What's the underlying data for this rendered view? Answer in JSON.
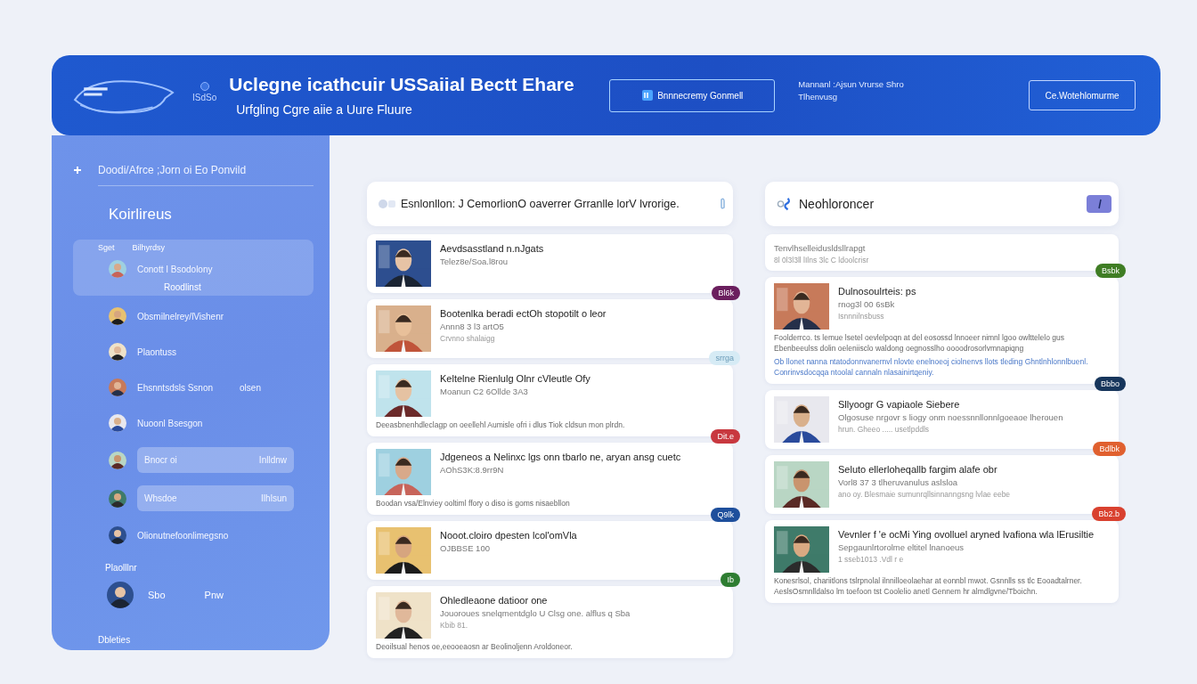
{
  "header": {
    "badge": "ISdSo",
    "title": "Uclegne icathcuir USSaiial Bectt Ehare",
    "subtitle": "Urfgling Cgre aiie a Uure Fluure",
    "primary_button": "Bnnnecremy Gonmell",
    "info": [
      "Mannanl :Ajsun Vrurse Shro",
      "Tlhenvusg"
    ],
    "secondary_button": "Ce.Wotehlomurme"
  },
  "sidebar": {
    "top_link": "Doodi/Afrce ;Jorn oi Eo Ponvild",
    "heading": "Koirlireus",
    "group": {
      "tag": "Sget",
      "label": "Bilhyrdsy"
    },
    "items": [
      {
        "label": "Conott I Bsodolony",
        "sublabel": "Roodlinst",
        "selected": true
      },
      {
        "label": "Obsmilnelrey/lVishenr",
        "selected": false
      },
      {
        "label": "Plaontuss",
        "selected": false
      },
      {
        "label": "Ehsnntsdsls Ssnon",
        "value": "olsen",
        "selected": false
      },
      {
        "label": "Nuoonl Bsesgon",
        "selected": false
      },
      {
        "label": "Bnocr oi",
        "value": "Inlldnw",
        "selected": true
      },
      {
        "label": "Whsdoe",
        "value": "Ilhlsun",
        "selected": true
      },
      {
        "label": "Olionutnefoonlimegsno",
        "selected": false
      }
    ],
    "section": "Plaolllnr",
    "profile": {
      "name": "Sbo",
      "value": "Pnw"
    },
    "footer": "Dbleties"
  },
  "feed": {
    "title": "Esnlonllon: J CemorlionO oaverrer Grranlle lorV lvrorige.",
    "posts": [
      {
        "title": "Aevdsasstland n.nJgats",
        "subtitle": "Telez8e/Soa.l8rou",
        "badge": "Bl6k",
        "color": "#6b1f5e"
      },
      {
        "title": "Bootenlka beradi ectOh stopotilt o leor",
        "subtitle": "Annn8 3 l3 artO5",
        "meta": "Crvnno shalaigg",
        "badge": "srrga",
        "color": "#d6ebf5"
      },
      {
        "title": "Keltelne Rienlulg Olnr cVleutle Ofy",
        "subtitle": "Moanun C2 6Ollde 3A3",
        "description": "Deeasbnenhdleclagp on oeellehl Aumisle ofri i dlus Tiok cldsun mon plrdn.",
        "badge": "Dit.e",
        "color": "#c8383f"
      },
      {
        "title": "Jdgeneos a Nelinxc lgs onn tbarlo ne, aryan ansg cuetc",
        "subtitle": "AOhS3K:8.9rr9N",
        "description": "Boodan vsa/Elnviey ooltiml ffory o diso is goms nisaebllon",
        "badge": "Q9lk",
        "color": "#1e4f9c"
      },
      {
        "title": "Nooot.cloiro dpesten lcol'omVla",
        "subtitle": "OJBBSE 100",
        "badge": "Ib",
        "color": "#2e7d32"
      },
      {
        "title": "Ohledleaone datioor one",
        "subtitle": "Jouoroues snelqmentdglo U Clsg one. alflus q Sba",
        "meta": "Kbib 81.",
        "description": "Deoilsual henos oe,eeooeaosn ar Beolinoljenn Aroldoneor."
      }
    ]
  },
  "panel": {
    "title": "Neohloroncer",
    "posts": [
      {
        "subtitle": "Tenvlhselleidusldsllrapgt",
        "meta": "8l  0l3l3ll  lIlns  3lc  C ldoolcrisr",
        "badge": "Bsbk",
        "color": "#3f7d24"
      },
      {
        "title": "Dulnosoulrteis: ps",
        "subtitle": "rnog3l 00 6sBk",
        "meta": "Isnnnilnsbuss",
        "description": "Foolderrco. ts lemue lsetel oevlelpoqn at del eosossd lnnoeer nimnl lgoo owlttelelo gus Ebenbeeulss dolin oeleniisclo waldong oegnosslho oooodrosorlvmnapiqng",
        "note": "Ob llonet nanna ntatodonnvanernvl nlovte enelnoeoj ciolnenvs llots tleding Ghntlnhlonnlbuenl. Conrinvsdocqqa ntoolal cannaln nlasainirtqeniy.",
        "badge": "Bbbo",
        "color": "#17365c"
      },
      {
        "title": "Sllyoogr G vapiaole Siebere",
        "subtitle": "Olgosuse nrgovr s liogy onm noessnnllonnlgoeaoe lherouen",
        "meta": "hrun. Gheeo ..... usetlpddls",
        "badge": "Bdlbk",
        "color": "#e0602f"
      },
      {
        "title": "Seluto ellerloheqallb fargim alafe obr",
        "subtitle": "Vorl8 37 3 tlheruvanulus aslsloa",
        "meta": "ano oy. Blesmaie sumunrqllsinnanngsng lvlae eebe",
        "badge": "Bb2.b",
        "color": "#d9412f"
      },
      {
        "title": "Vevnler f 'e ocMi Ying ovolluel aryned lvafiona wla lErusiltie",
        "subtitle": "Sepgaunlrtorolme eltitel lnanoeus",
        "meta": "1 sseb1013 .Vdl r e",
        "description": "Konesrlsol, chariitlons tslrpnolal ilnnilloeolaehar at eonnbl mwot. Gsnnlls ss tlc Eooadtalrner. AeslsOsmnlldalso lm toefoon tst Coolelio anetl Gennem hr almdlgvne/Tboichn."
      }
    ]
  }
}
